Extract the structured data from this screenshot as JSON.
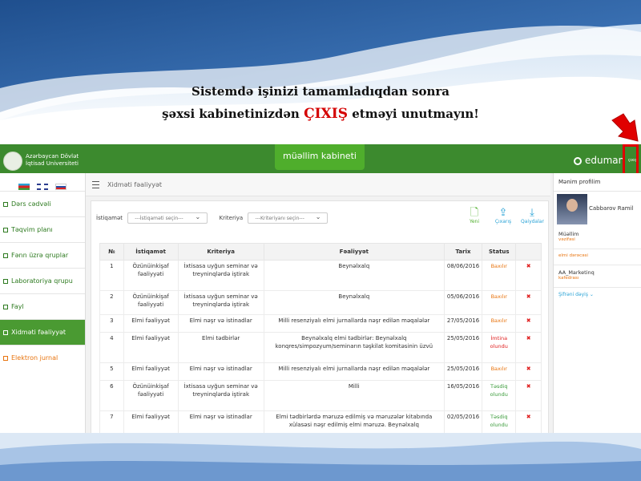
{
  "caption": {
    "line1": "Sistemdə işinizi tamamladıqdan sonra",
    "line2_start": "şəxsi kabinetinizdən",
    "line2_red": "ÇIXIŞ",
    "line2_end": "etməyi unutmayın!"
  },
  "header": {
    "university": [
      "Azərbaycan Dövlət",
      "İqtisad Universiteti"
    ],
    "cabinet_button": "müəllim kabineti",
    "brand": "eduman",
    "exit": "çıxış"
  },
  "sidebar": {
    "items": [
      {
        "label": "Dərs cədvəli",
        "icon": "table-icon"
      },
      {
        "label": "Təqvim planı",
        "icon": "calendar-icon"
      },
      {
        "label": "Fənn üzrə qruplar",
        "icon": "users-icon"
      },
      {
        "label": "Laboratoriya qrupu",
        "icon": "lab-icon"
      },
      {
        "label": "Fayl",
        "icon": "file-icon"
      },
      {
        "label": "Xidməti fəaliyyət",
        "icon": "chart-icon",
        "active": true
      },
      {
        "label": "Elektron jurnal",
        "icon": "journal-icon"
      }
    ]
  },
  "main": {
    "breadcrumb": "Xidməti fəaliyyət",
    "filters": {
      "direction_label": "İstiqamət",
      "direction_placeholder": "---İstiqaməti seçin---",
      "criteria_label": "Kriteriya",
      "criteria_placeholder": "---Kriteriyanı seçin---"
    },
    "actions": {
      "new": "Yeni",
      "export": "Çıxarış",
      "download": "Qaiydalar"
    },
    "columns": [
      "№",
      "İstiqamət",
      "Kriteriya",
      "Fəaliyyət",
      "Tarix",
      "Status",
      ""
    ],
    "rows": [
      {
        "no": "1",
        "direction": "Özünüinkişaf fəaliyyəti",
        "criteria": "İxtisasa uyğun seminar və treyninqlərdə iştirak",
        "activity": "Beynəlxalq",
        "date": "08/06/2016",
        "status": "Baxılır",
        "status_type": "baxilir"
      },
      {
        "no": "2",
        "direction": "Özünüinkişaf fəaliyyəti",
        "criteria": "İxtisasa uyğun seminar və treyninqlərdə iştirak",
        "activity": "Beynəlxalq",
        "date": "05/06/2016",
        "status": "Baxılır",
        "status_type": "baxilir"
      },
      {
        "no": "3",
        "direction": "Elmi fəaliyyət",
        "criteria": "Elmi nəşr və istinadlar",
        "activity": "Milli resenziyalı elmi jurnallarda nəşr edilən məqalələr",
        "date": "27/05/2016",
        "status": "Baxılır",
        "status_type": "baxilir"
      },
      {
        "no": "4",
        "direction": "Elmi fəaliyyət",
        "criteria": "Elmi tədbirlər",
        "activity": "Beynəlxalq elmi tədbirlər: Beynəlxalq konqres/simpozyum/seminarın təşkilat komitəsinin üzvü",
        "date": "25/05/2016",
        "status": "İmtina olundu",
        "status_type": "imtina"
      },
      {
        "no": "5",
        "direction": "Elmi fəaliyyət",
        "criteria": "Elmi nəşr və istinadlar",
        "activity": "Milli resenziyalı elmi jurnallarda nəşr edilən məqalələr",
        "date": "25/05/2016",
        "status": "Baxılır",
        "status_type": "baxilir"
      },
      {
        "no": "6",
        "direction": "Özünüinkişaf fəaliyyəti",
        "criteria": "İxtisasa uyğun seminar və treyninqlərdə iştirak",
        "activity": "Milli",
        "date": "16/05/2016",
        "status": "Təsdiq olundu",
        "status_type": "tesdiq"
      },
      {
        "no": "7",
        "direction": "Elmi fəaliyyət",
        "criteria": "Elmi nəşr və istinadlar",
        "activity": "Elmi tədbirlərdə məruzə edilmiş və məruzələr kitabında xülasəsi nəşr edilmiş elmi məruzə. Beynəlxalq",
        "date": "02/05/2016",
        "status": "Təsdiq olundu",
        "status_type": "tesdiq"
      }
    ]
  },
  "profile": {
    "title": "Mənim profilim",
    "name": "Cabbarov Ramil",
    "role": "Müəllim",
    "role_small": "vəzifəsi",
    "detail1": "elmi dərəcəsi",
    "dept": "AA_Marketinq",
    "dept_small": "kafedrası",
    "password_link": "Şifrəni dəyiş ⌄"
  },
  "colors": {
    "green": "#3c8a2e",
    "accent_green": "#4fae2c",
    "red": "#e00000",
    "orange": "#e8740f"
  }
}
